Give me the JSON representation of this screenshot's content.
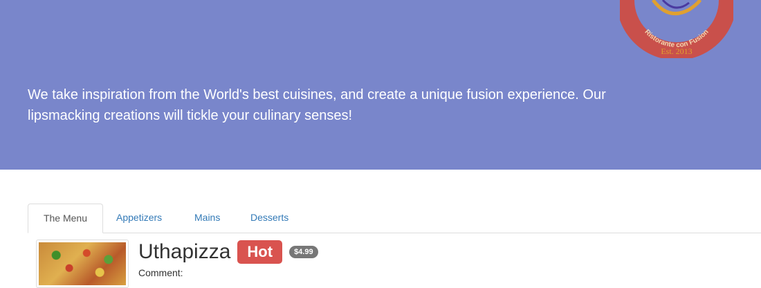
{
  "header": {
    "tagline": "We take inspiration from the World's best cuisines, and create a unique fusion experience. Our lipsmacking creations will tickle your culinary senses!",
    "logo": {
      "text": "Ristorante con Fusion",
      "established": "Est. 2013",
      "colors": {
        "ring": "#c9504b",
        "accent": "#e0a030"
      }
    },
    "background_color": "#7986cb"
  },
  "tabs": [
    {
      "label": "The Menu",
      "active": true
    },
    {
      "label": "Appetizers",
      "active": false
    },
    {
      "label": "Mains",
      "active": false
    },
    {
      "label": "Desserts",
      "active": false
    }
  ],
  "dish": {
    "name": "Uthapizza",
    "label": "Hot",
    "price": "$4.99",
    "comment_label": "Comment:",
    "image": "pizza-thumbnail"
  },
  "colors": {
    "link": "#337ab7",
    "danger": "#d9534f",
    "badge": "#777777"
  }
}
